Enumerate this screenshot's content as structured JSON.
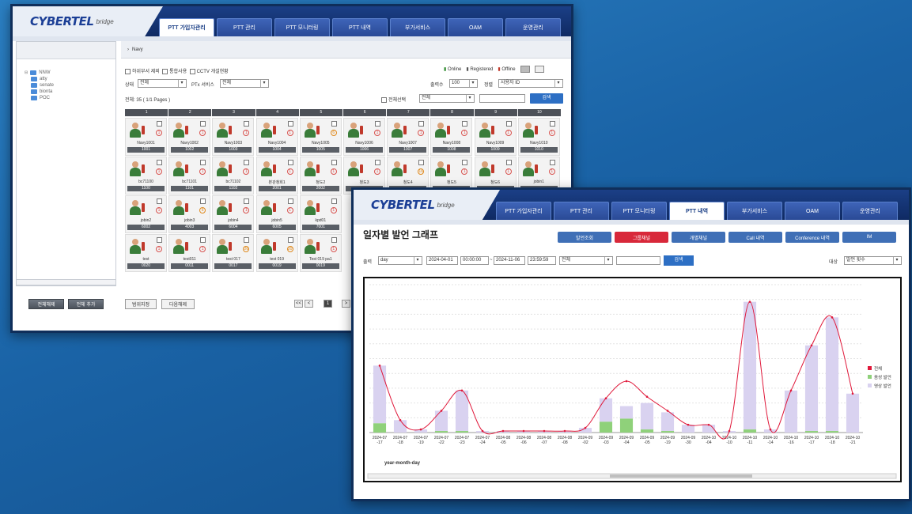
{
  "brand": {
    "logo": "CYBERTEL",
    "logo_sub": "bridge"
  },
  "w1": {
    "tabs": [
      "PTT 가입자관리",
      "PTT 관리",
      "PTT 모니터링",
      "PTT 내역",
      "부가서비스",
      "OAM",
      "운영관리"
    ],
    "active_tab": 0,
    "breadcrumb": "Navy",
    "tree": {
      "root": "NNW",
      "items": [
        "atty",
        "senate",
        "bionta",
        "POC"
      ]
    },
    "tree_buttons": [
      "전체해제",
      "전체 추가"
    ],
    "filters": {
      "checks": [
        "하위부서 제외",
        "통합사용",
        "CCTV 개설현황"
      ],
      "status_label": "상태",
      "status_value": "전체",
      "service_label": "PTx 서비스",
      "service_value": "전체",
      "count_label": "출력수",
      "count_value": "100",
      "sort_label": "정렬",
      "sort_value": "사용자 ID",
      "total": "전체: 35 ( 1/1 Pages )",
      "select_all": "전체선택",
      "search_type": "전체",
      "search_btn": "검색"
    },
    "status_legend": [
      "Online",
      "Registered",
      "Offline"
    ],
    "columns": [
      "1",
      "2",
      "3",
      "4",
      "5",
      "6",
      "7",
      "8",
      "9",
      "10"
    ],
    "rows": [
      [
        [
          "Navy1001",
          "1001",
          "1"
        ],
        [
          "Navy1002",
          "1002",
          "1"
        ],
        [
          "Navy1003",
          "1003",
          "1"
        ],
        [
          "Navy1004",
          "1004",
          "1"
        ],
        [
          "Navy1005",
          "1005",
          "6"
        ],
        [
          "Navy1006",
          "1006",
          "1"
        ],
        [
          "Navy1007",
          "1007",
          "1"
        ],
        [
          "Navy1008",
          "1008",
          "1"
        ],
        [
          "Navy1009",
          "1009",
          "1"
        ],
        [
          "Navy1010",
          "1010",
          "1"
        ]
      ],
      [
        [
          "bc71100",
          "1100",
          "1"
        ],
        [
          "bc71101",
          "1101",
          "1"
        ],
        [
          "bc71102",
          "1102",
          "1"
        ],
        [
          "본관청회1",
          "2001",
          "1"
        ],
        [
          "청도2",
          "2002",
          "1"
        ],
        [
          "청도3",
          "",
          "1"
        ],
        [
          "청도4",
          "",
          "16"
        ],
        [
          "청도5",
          "",
          "1"
        ],
        [
          "청도6",
          "",
          "1"
        ],
        [
          "jobin1",
          "",
          "1"
        ]
      ],
      [
        [
          "jobin2",
          "6002",
          "1"
        ],
        [
          "jobin3",
          "4003",
          "6"
        ],
        [
          "jobin4",
          "6004",
          "1"
        ],
        [
          "jobin5",
          "6005",
          "1"
        ],
        [
          "kpd01",
          "7001",
          "1"
        ]
      ],
      [
        [
          "test",
          "0020",
          "1"
        ],
        [
          "test011",
          "0011",
          "1"
        ],
        [
          "test 017",
          "0017",
          "26"
        ],
        [
          "test 019",
          "0019",
          "20"
        ],
        [
          "Test 019 pa1",
          "0019",
          "1"
        ]
      ]
    ],
    "bottom_buttons": [
      "범위지정",
      "다음해제"
    ],
    "pager": [
      "<<",
      "<",
      "1",
      ">"
    ]
  },
  "w2": {
    "tabs": [
      "PTT 가입자관리",
      "PTT 관리",
      "PTT 모니터링",
      "PTT 내역",
      "부가서비스",
      "OAM",
      "운영관리"
    ],
    "active_tab": 3,
    "title": "일자별 발언 그래프",
    "subtabs": [
      "발언조회",
      "그룹채널",
      "개별채널",
      "Call 내역",
      "Conference 내역",
      "IM"
    ],
    "active_subtab": 1,
    "filters": {
      "output_label": "출력",
      "period": "day",
      "start_date": "2024-04-01",
      "start_time": "00:00:00",
      "sep": "~",
      "end_date": "2024-11-06",
      "end_time": "23:59:59",
      "group": "전체",
      "search_btn": "검색",
      "target_label": "대상",
      "target_value": "발언 횟수"
    },
    "colors": {
      "total": "#e0183a",
      "voice": "#8fd17a",
      "video": "#d9d2f0"
    },
    "chart_data": {
      "type": "bar",
      "xlabel": "year-month-day",
      "categories": [
        "2024-07\n-17",
        "2024-07\n-18",
        "2024-07\n-19",
        "2024-07\n-22",
        "2024-07\n-23",
        "2024-07\n-24",
        "2024-08\n-05",
        "2024-08\n-06",
        "2024-08\n-07",
        "2024-08\n-08",
        "2024-09\n-02",
        "2024-09\n-03",
        "2024-09\n-04",
        "2024-09\n-05",
        "2024-09\n-19",
        "2024-09\n-30",
        "2024-10\n-04",
        "2024-10\n-10",
        "2024-10\n-11",
        "2024-10\n-14",
        "2024-10\n-16",
        "2024-10\n-17",
        "2024-10\n-18",
        "2024-10\n-21"
      ],
      "series": [
        {
          "name": "전체",
          "type": "line",
          "values": [
            43,
            8,
            2,
            14,
            27,
            1,
            1,
            1,
            1,
            1,
            3,
            22,
            33,
            23,
            14,
            5,
            5,
            1,
            84,
            2,
            27,
            56,
            74,
            25
          ]
        },
        {
          "name": "음성 발언",
          "values": [
            6,
            0,
            0,
            1,
            1,
            0,
            0,
            0,
            0,
            0,
            0,
            7,
            9,
            2,
            1,
            0,
            0,
            0,
            2,
            0,
            0,
            1,
            1,
            0
          ]
        },
        {
          "name": "영상 발언",
          "values": [
            37,
            8,
            2,
            13,
            26,
            1,
            1,
            1,
            1,
            1,
            3,
            15,
            8,
            17,
            12,
            5,
            5,
            1,
            82,
            2,
            27,
            55,
            73,
            25
          ]
        }
      ],
      "ylim": [
        0,
        95
      ],
      "grid": true,
      "legend": "right"
    }
  }
}
